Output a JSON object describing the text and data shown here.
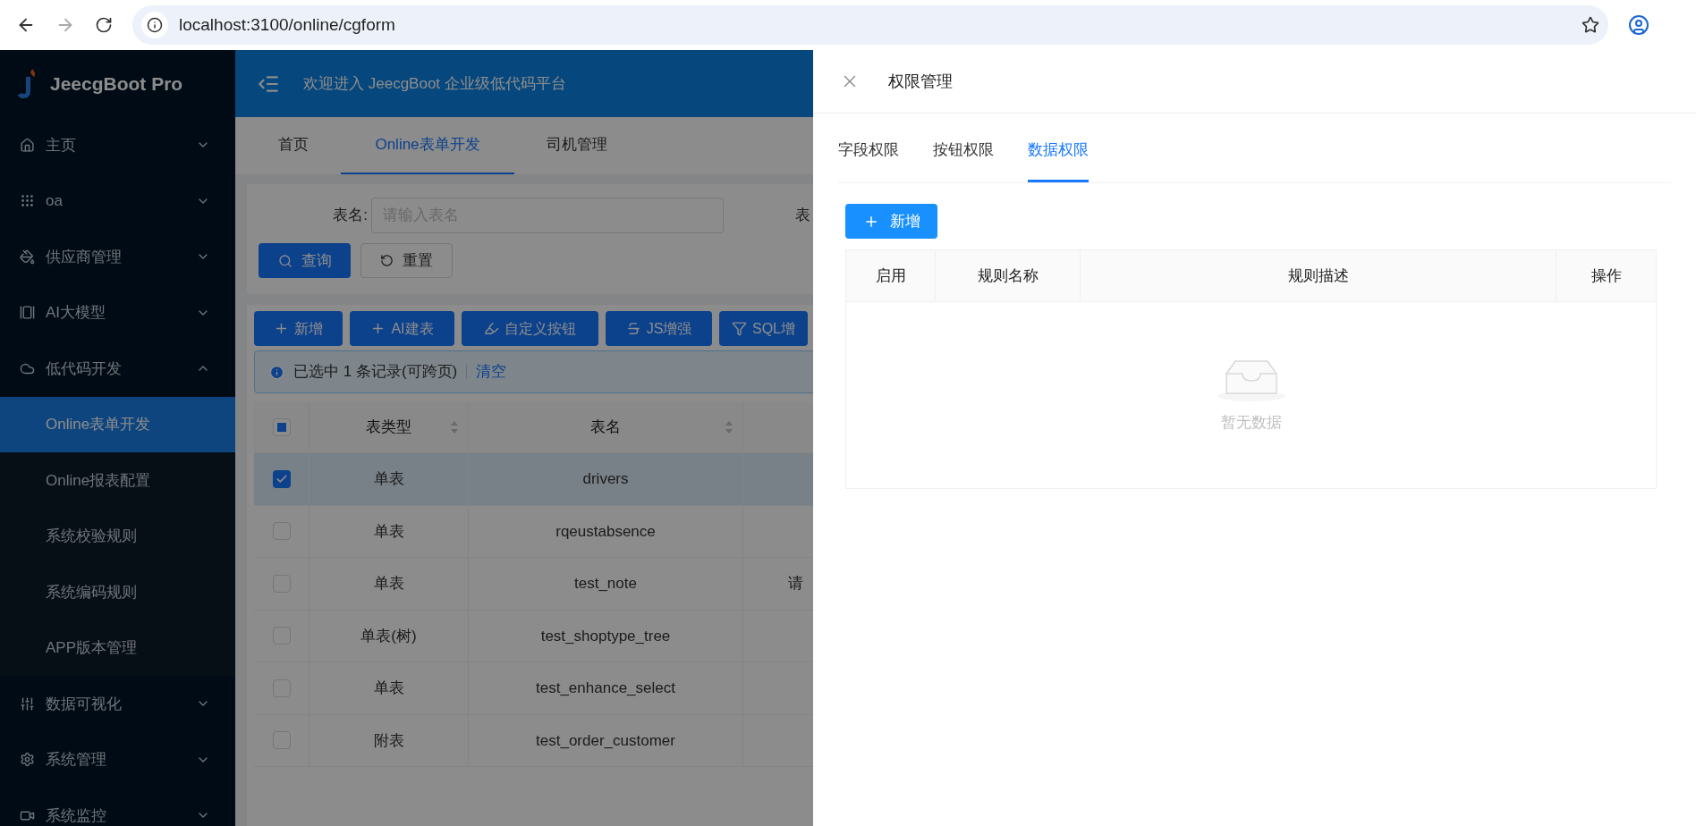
{
  "browser": {
    "url": "localhost:3100/online/cgform"
  },
  "sidebar": {
    "brand": "JeecgBoot Pro",
    "items": [
      {
        "label": "主页",
        "expanded": false
      },
      {
        "label": "oa",
        "expanded": false
      },
      {
        "label": "供应商管理",
        "expanded": false
      },
      {
        "label": "AI大模型",
        "expanded": false
      },
      {
        "label": "低代码开发",
        "expanded": true,
        "children": [
          {
            "label": "Online表单开发",
            "selected": true
          },
          {
            "label": "Online报表配置",
            "selected": false
          },
          {
            "label": "系统校验规则",
            "selected": false
          },
          {
            "label": "系统编码规则",
            "selected": false
          },
          {
            "label": "APP版本管理",
            "selected": false
          }
        ]
      },
      {
        "label": "数据可视化",
        "expanded": false
      },
      {
        "label": "系统管理",
        "expanded": false
      },
      {
        "label": "系统监控",
        "expanded": false
      }
    ]
  },
  "header": {
    "welcome": "欢迎进入 JeecgBoot 企业级低代码平台"
  },
  "tabs": [
    {
      "label": "首页",
      "selected": false
    },
    {
      "label": "Online表单开发",
      "selected": true
    },
    {
      "label": "司机管理",
      "selected": false
    }
  ],
  "search": {
    "fields": [
      {
        "label": "表名:",
        "placeholder": "请输入表名"
      },
      {
        "label": "表"
      }
    ],
    "buttons": [
      {
        "label": "查询",
        "kind": "primary"
      },
      {
        "label": "重置",
        "kind": "default"
      }
    ]
  },
  "toolbar": [
    {
      "label": "新增"
    },
    {
      "label": "AI建表"
    },
    {
      "label": "自定义按钮"
    },
    {
      "label": "JS增强"
    },
    {
      "label": "SQL增"
    }
  ],
  "alert": {
    "message": "已选中 1 条记录(可跨页)",
    "action": "清空"
  },
  "table": {
    "header_checkbox": {
      "indeterminate": true
    },
    "columns": [
      {
        "label": "表类型",
        "sortable": true
      },
      {
        "label": "表名",
        "sortable": true
      }
    ],
    "rows": [
      {
        "checked": true,
        "type": "单表",
        "name": "drivers"
      },
      {
        "checked": false,
        "type": "单表",
        "name": "rqeustabsence"
      },
      {
        "checked": false,
        "type": "单表",
        "name": "test_note",
        "column_3": "请"
      },
      {
        "checked": false,
        "type": "单表(树)",
        "name": "test_shoptype_tree"
      },
      {
        "checked": false,
        "type": "单表",
        "name": "test_enhance_select"
      },
      {
        "checked": false,
        "type": "附表",
        "name": "test_order_customer"
      }
    ]
  },
  "drawer": {
    "title": "权限管理",
    "tabs": [
      {
        "label": "字段权限",
        "selected": false
      },
      {
        "label": "按钮权限",
        "selected": false
      },
      {
        "label": "数据权限",
        "selected": true
      }
    ],
    "add_button": "新增",
    "table": {
      "columns": [
        "启用",
        "规则名称",
        "规则描述",
        "操作"
      ],
      "empty_text": "暂无数据"
    }
  }
}
